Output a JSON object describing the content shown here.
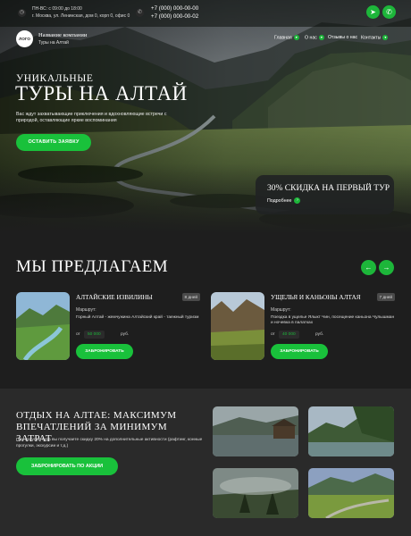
{
  "topbar": {
    "hours": "ПН-ВС: с 09:00 до 18:00",
    "address": "г. Москва, ул. Ленинская, дом 0, корп 0, офис 0",
    "phone1": "+7 (000) 000-00-00",
    "phone2": "+7 (000) 000-00-02",
    "clock_icon": "clock-icon",
    "pin_icon": "location-pin-icon",
    "phone_icon": "phone-icon",
    "social": [
      "telegram-icon",
      "whatsapp-icon"
    ]
  },
  "header": {
    "logo": "ЛОГО",
    "company_name": "Название компании",
    "company_tagline": "Туры на Алтай"
  },
  "nav": [
    {
      "label": "Главная"
    },
    {
      "label": "О нас"
    },
    {
      "label": "Отзывы о нас"
    },
    {
      "label": "Контакты"
    }
  ],
  "hero": {
    "pretitle": "УНИКАЛЬНЫЕ",
    "title": "ТУРЫ НА АЛТАЙ",
    "description": "Вас ждут захватывающие приключения и вдохновляющие встречи с природой, оставляющие яркие воспоминания",
    "cta": "ОСТАВИТЬ ЗАЯВКУ"
  },
  "promo": {
    "title": "30% СКИДКА НА ПЕРВЫЙ ТУР",
    "link": "Подробнее"
  },
  "offers": {
    "title": "МЫ ПРЕДЛАГАЕМ",
    "tours": [
      {
        "title": "АЛТАЙСКИЕ ИЗВИЛИНЫ",
        "badge": "8 дней",
        "route_label": "Маршрут:",
        "route": "Горный Алтай - жемчужина Алтайский край - таежный туризм",
        "price_from": "от",
        "price": "50 000",
        "currency": "руб.",
        "button": "ЗАБРОНИРОВАТЬ"
      },
      {
        "title": "УЩЕЛЬЯ И КАНЬОНЫ АЛТАЯ",
        "badge": "7 дней",
        "route_label": "Маршрут:",
        "route": "Поездка в ущелье Ялыкт Чин, посещение каньона Чулышман и ночевка в палатках",
        "price_from": "от",
        "price": "40 000",
        "currency": "руб.",
        "button": "ЗАБРОНИРОВАТЬ"
      }
    ]
  },
  "bottom": {
    "title": "ОТДЫХ НА АЛТАЕ: МАКСИМУМ ВПЕЧАТЛЕНИЙ ЗА МИНИМУМ ЗАТРАТ",
    "description": "При покупке тура вы получаете скидку 20% на дополнительные активности (рафтинг, конные прогулки, экскурсии и т.д.)",
    "button": "ЗАБРОНИРОВАТЬ ПО АКЦИИ"
  },
  "colors": {
    "accent": "#19c13b",
    "background": "#1e1e1e",
    "panel": "#2a2a2a"
  }
}
